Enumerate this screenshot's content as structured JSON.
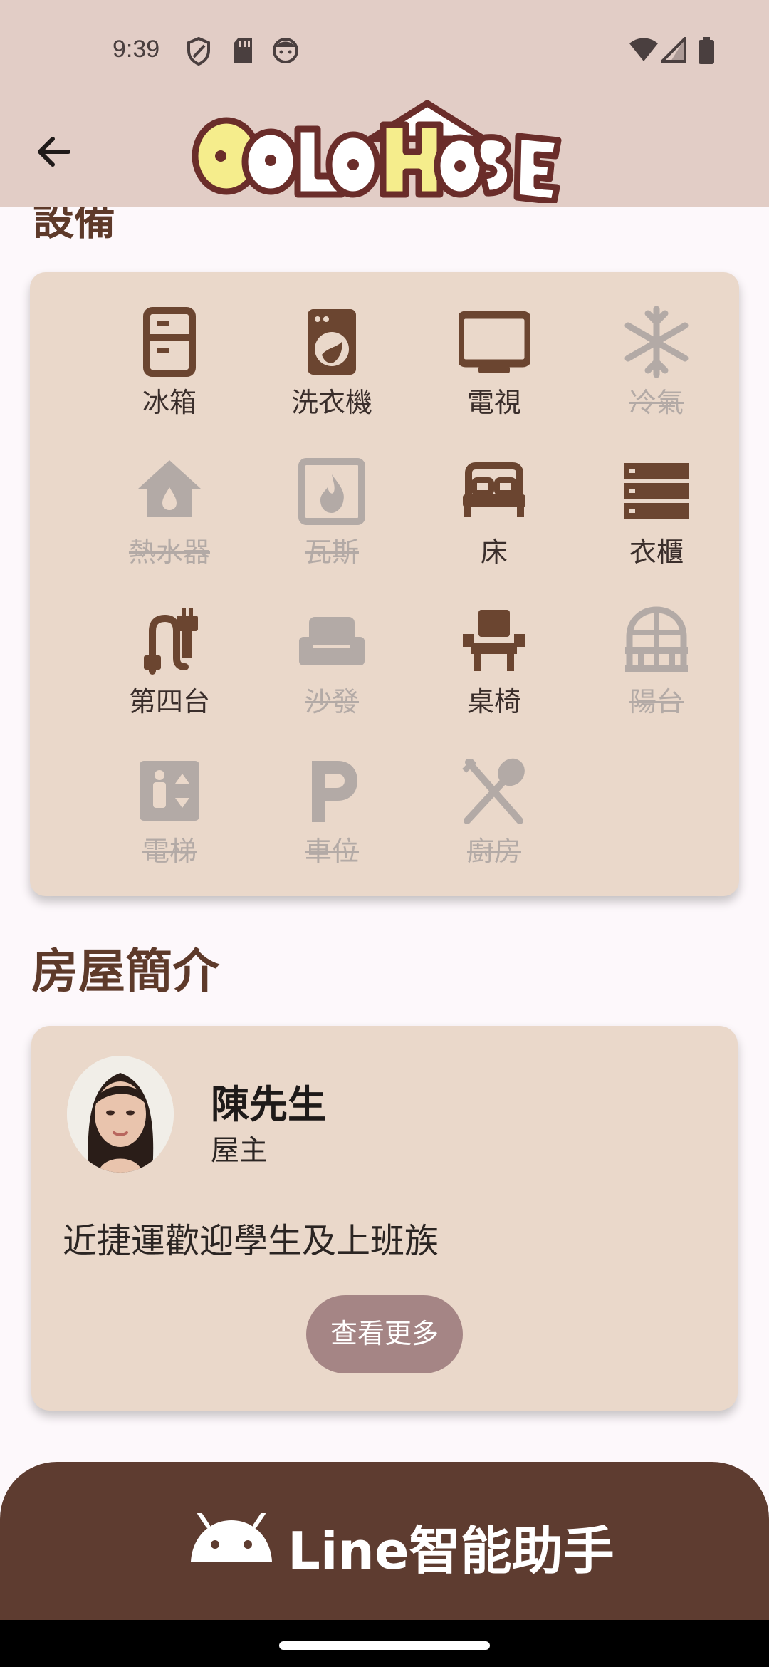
{
  "status_bar": {
    "time": "9:39"
  },
  "app_bar": {
    "logo_text": "GOLD HOUSE"
  },
  "equipment": {
    "heading": "設備",
    "items": [
      {
        "label": "冰箱",
        "icon": "fridge-icon",
        "available": true
      },
      {
        "label": "洗衣機",
        "icon": "washer-icon",
        "available": true
      },
      {
        "label": "電視",
        "icon": "tv-icon",
        "available": true
      },
      {
        "label": "冷氣",
        "icon": "snowflake-icon",
        "available": false
      },
      {
        "label": "熱水器",
        "icon": "water-heater-icon",
        "available": false
      },
      {
        "label": "瓦斯",
        "icon": "gas-fire-icon",
        "available": false
      },
      {
        "label": "床",
        "icon": "bed-icon",
        "available": true
      },
      {
        "label": "衣櫃",
        "icon": "wardrobe-icon",
        "available": true
      },
      {
        "label": "第四台",
        "icon": "cable-plug-icon",
        "available": true
      },
      {
        "label": "沙發",
        "icon": "sofa-icon",
        "available": false
      },
      {
        "label": "桌椅",
        "icon": "chair-icon",
        "available": true
      },
      {
        "label": "陽台",
        "icon": "balcony-icon",
        "available": false
      },
      {
        "label": "電梯",
        "icon": "elevator-icon",
        "available": false
      },
      {
        "label": "車位",
        "icon": "parking-icon",
        "available": false
      },
      {
        "label": "廚房",
        "icon": "kitchen-utensils-icon",
        "available": false
      }
    ]
  },
  "profile": {
    "heading": "房屋簡介",
    "owner_name": "陳先生",
    "owner_role": "屋主",
    "intro": "近捷運歡迎學生及上班族",
    "more_button": "查看更多"
  },
  "line_assistant": {
    "label": "Line智能助手"
  },
  "colors": {
    "brown": "#5e3c30",
    "card": "#ead8ca",
    "disabled": "#b3aaa6",
    "button": "#a58585"
  }
}
